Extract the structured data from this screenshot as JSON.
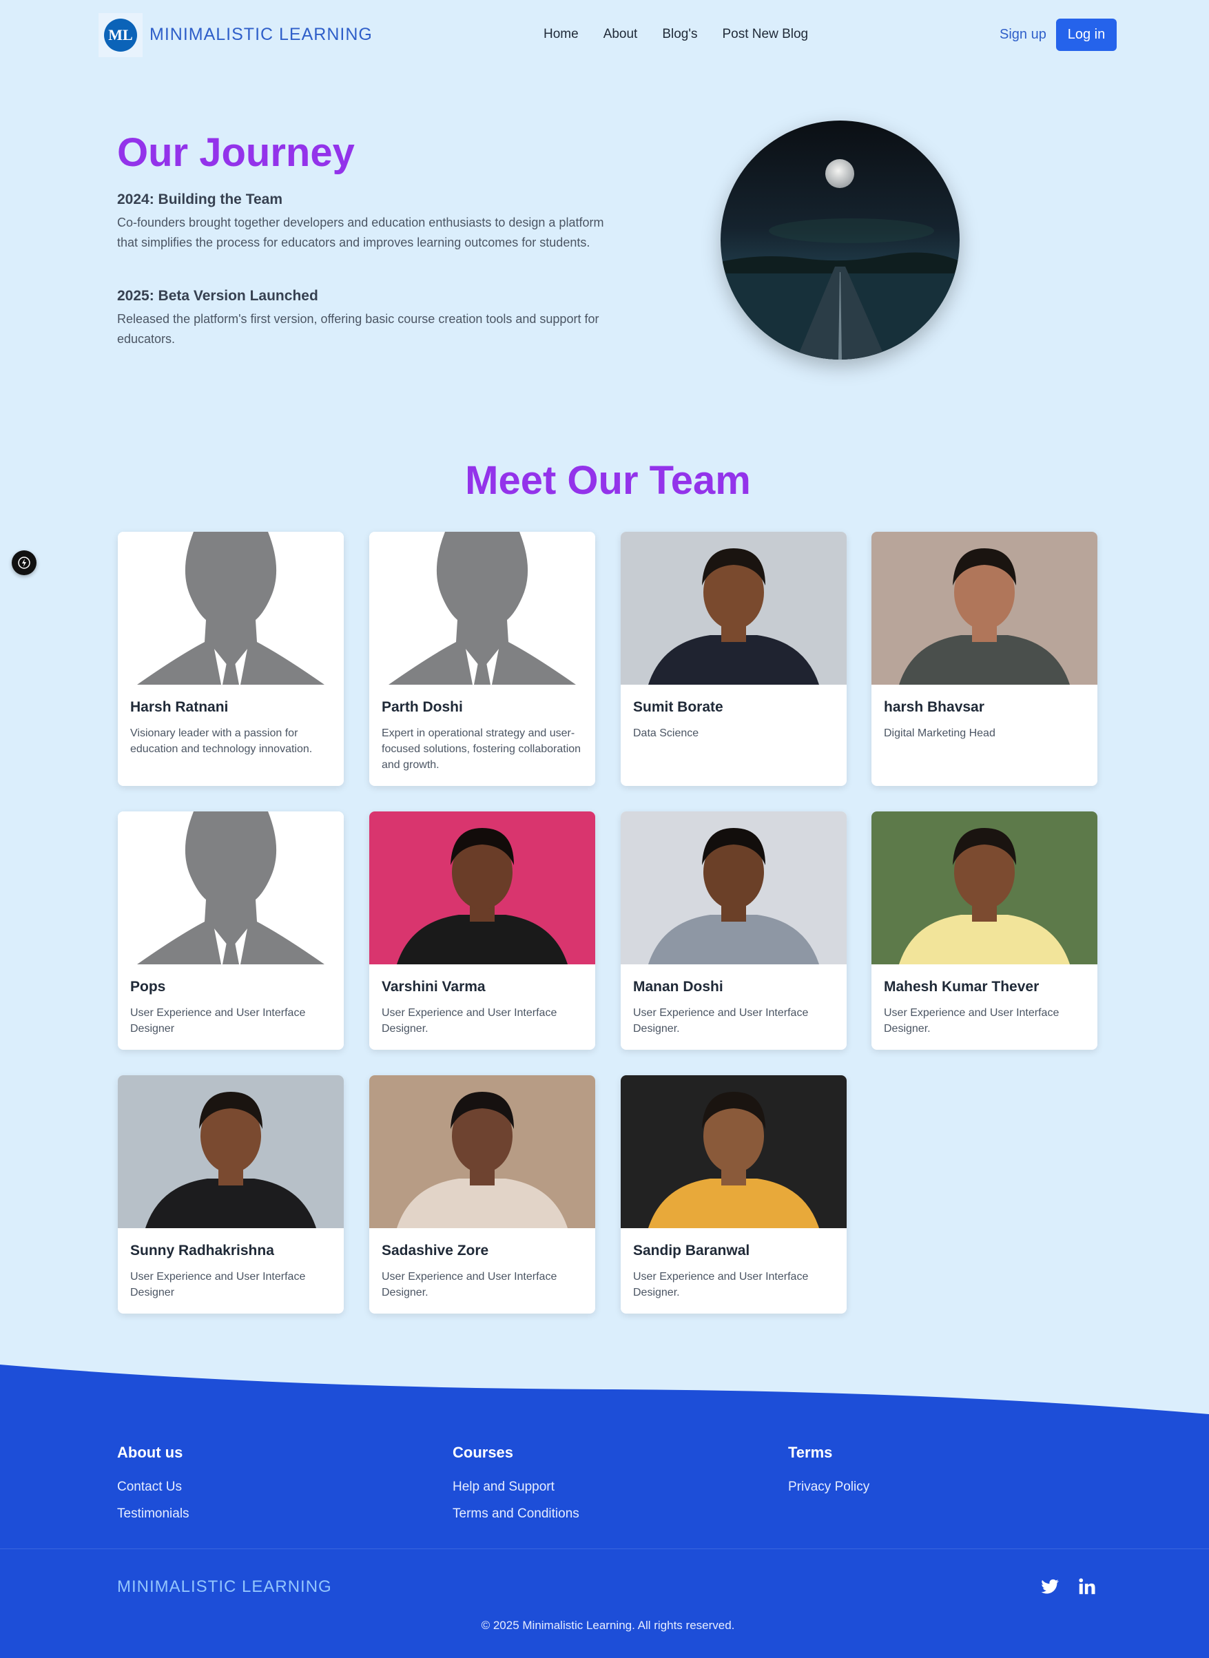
{
  "header": {
    "logo_text": "ML",
    "brand": "MINIMALISTIC LEARNING",
    "nav": [
      "Home",
      "About",
      "Blog's",
      "Post New Blog"
    ],
    "signup": "Sign up",
    "login": "Log in"
  },
  "journey": {
    "title": "Our Journey",
    "milestones": [
      {
        "title": "2024: Building the Team",
        "text": "Co-founders brought together developers and education enthusiasts to design a platform that simplifies the process for educators and improves learning outcomes for students."
      },
      {
        "title": "2025: Beta Version Launched",
        "text": "Released the platform's first version, offering basic course creation tools and support for educators."
      }
    ]
  },
  "team": {
    "title": "Meet Our Team",
    "members": [
      {
        "name": "Harsh Ratnani",
        "role": "Visionary leader with a passion for education and technology innovation."
      },
      {
        "name": "Parth Doshi",
        "role": "Expert in operational strategy and user-focused solutions, fostering collaboration and growth."
      },
      {
        "name": "Sumit Borate",
        "role": "Data Science"
      },
      {
        "name": "harsh Bhavsar",
        "role": "Digital Marketing Head"
      },
      {
        "name": "Pops",
        "role": "User Experience and User Interface Designer"
      },
      {
        "name": "Varshini Varma",
        "role": "User Experience and User Interface Designer."
      },
      {
        "name": "Manan Doshi",
        "role": "User Experience and User Interface Designer."
      },
      {
        "name": "Mahesh Kumar Thever",
        "role": "User Experience and User Interface Designer."
      },
      {
        "name": "Sunny Radhakrishna",
        "role": "User Experience and User Interface Designer"
      },
      {
        "name": "Sadashive Zore",
        "role": "User Experience and User Interface Designer."
      },
      {
        "name": "Sandip Baranwal",
        "role": "User Experience and User Interface Designer."
      }
    ]
  },
  "footer": {
    "columns": [
      {
        "title": "About us",
        "links": [
          "Contact Us",
          "Testimonials"
        ]
      },
      {
        "title": "Courses",
        "links": [
          "Help and Support",
          "Terms and Conditions"
        ]
      },
      {
        "title": "Terms",
        "links": [
          "Privacy Policy"
        ]
      }
    ],
    "brand": "MINIMALISTIC LEARNING",
    "copyright": "© 2025 Minimalistic Learning. All rights reserved.",
    "social_icons": [
      "twitter-icon",
      "linkedin-icon"
    ]
  },
  "colors": {
    "page_bg": "#dbeefc",
    "accent_purple": "#9333ea",
    "brand_blue": "#2f5fc9",
    "button_blue": "#2563eb",
    "footer_blue": "#1d4ed8"
  }
}
